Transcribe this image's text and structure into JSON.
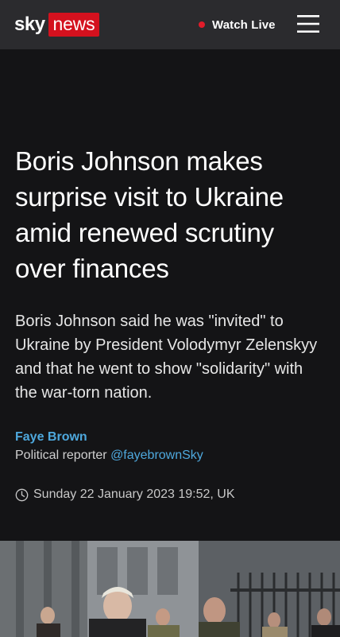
{
  "header": {
    "brand_sky": "sky",
    "brand_news": "news",
    "watch_live_label": "Watch Live",
    "menu_icon": "hamburger-menu-icon",
    "colors": {
      "header_bg": "#2b2b2e",
      "brand_red": "#d4111e",
      "live_dot": "#e11c2a"
    }
  },
  "article": {
    "headline": "Boris Johnson makes surprise visit to Ukraine amid renewed scrutiny over finances",
    "standfirst": "Boris Johnson said he was \"invited\" to Ukraine by President Volodymyr Zelenskyy and that he went to show \"solidarity\" with the war-torn nation.",
    "author": {
      "name": "Faye Brown",
      "role": "Political reporter",
      "handle": "@fayebrownSky"
    },
    "timestamp": "Sunday 22 January 2023 19:52, UK",
    "timestamp_icon": "clock-icon",
    "hero_image": "photo-icon",
    "colors": {
      "page_bg": "#141416",
      "link": "#4ea8dd"
    }
  }
}
